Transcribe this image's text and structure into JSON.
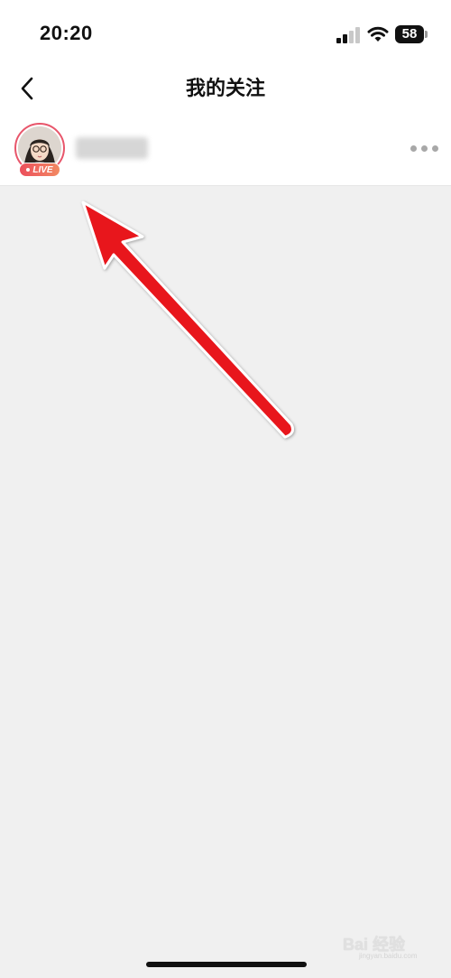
{
  "status_bar": {
    "time": "20:20",
    "battery_level": "58",
    "signal_bars_active": 2,
    "signal_bars_total": 4
  },
  "nav": {
    "title": "我的关注",
    "back_icon": "chevron-left-icon"
  },
  "following_list": [
    {
      "live_badge": "LIVE",
      "username_blurred": true,
      "more_icon": "more-horizontal-icon"
    }
  ],
  "colors": {
    "live_gradient_start": "#ec4f5c",
    "live_gradient_end": "#f28a63",
    "avatar_ring": "#e8566b",
    "arrow": "#e8121a",
    "background": "#f0f0f0"
  },
  "watermark": {
    "text": "Bai 经验",
    "sub": "jingyan.baidu.com"
  }
}
